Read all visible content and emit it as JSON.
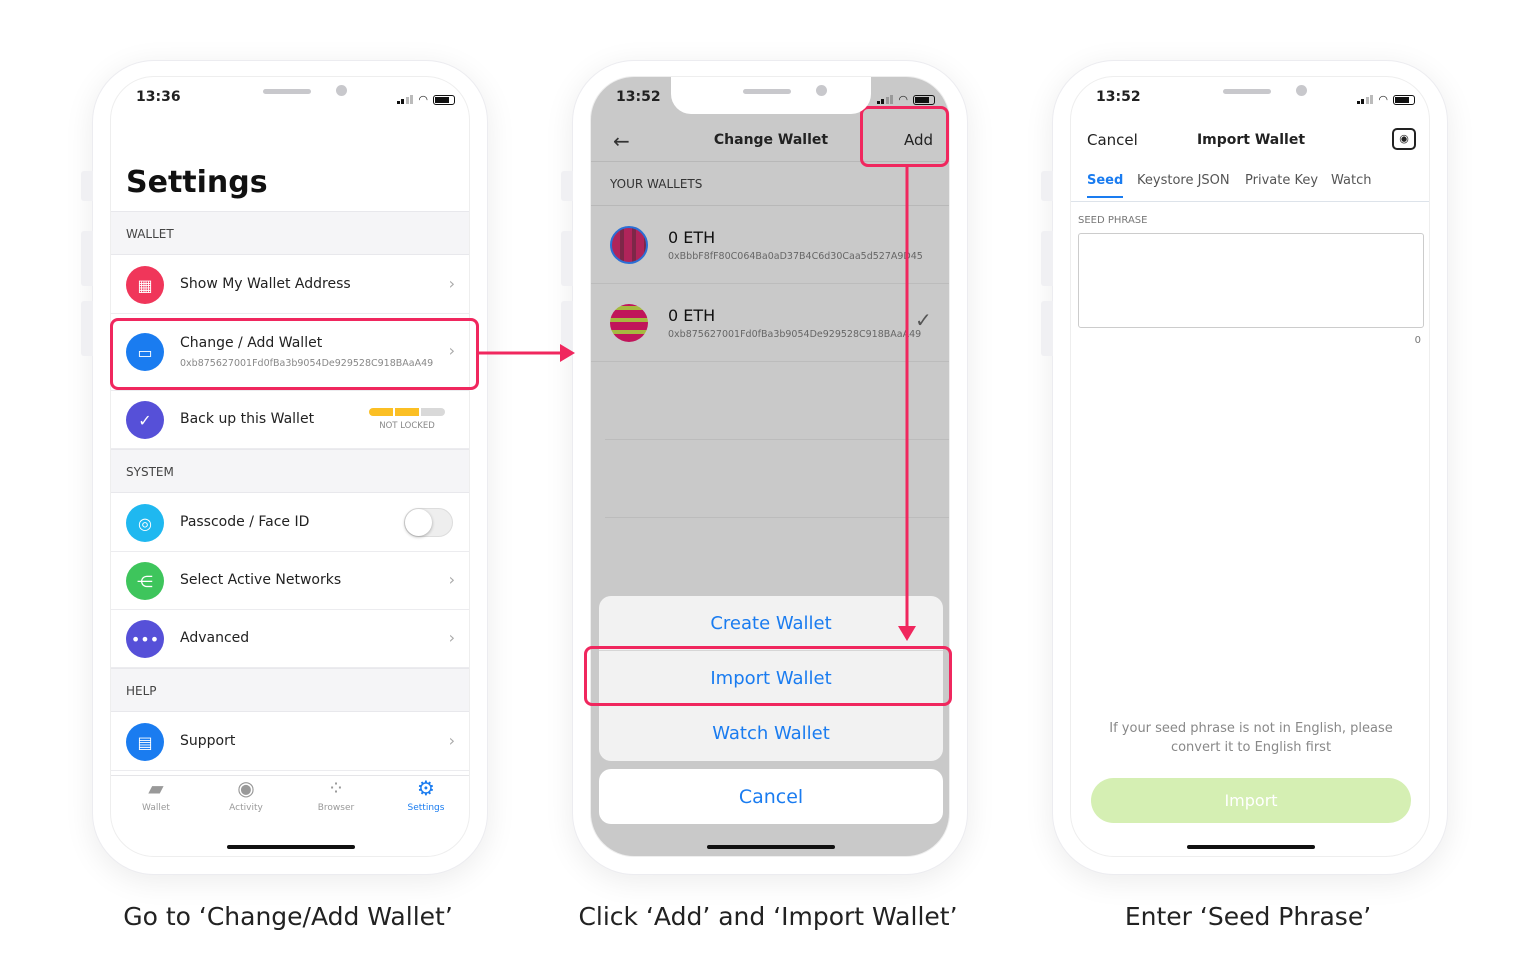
{
  "colors": {
    "accent": "#1a7cf0",
    "highlight": "#f0275e",
    "import_disabled": "#d5efb3"
  },
  "phone1": {
    "time": "13:36",
    "title": "Settings",
    "sections": {
      "wallet": "WALLET",
      "system": "SYSTEM",
      "help": "HELP"
    },
    "rows": {
      "show_address": "Show My Wallet Address",
      "change_wallet": "Change / Add Wallet",
      "change_wallet_address": "0xb875627001Fd0fBa3b9054De929528C918BAaA49",
      "backup": "Back up this Wallet",
      "backup_status": "NOT LOCKED",
      "backup_progress": "2 of 3",
      "passcode": "Passcode / Face ID",
      "passcode_enabled": false,
      "networks": "Select Active Networks",
      "advanced": "Advanced",
      "support": "Support"
    },
    "tabs": [
      {
        "label": "Wallet",
        "icon": "wallet-icon"
      },
      {
        "label": "Activity",
        "icon": "activity-icon"
      },
      {
        "label": "Browser",
        "icon": "browser-icon"
      },
      {
        "label": "Settings",
        "icon": "gear-icon",
        "active": true
      }
    ]
  },
  "phone2": {
    "time": "13:52",
    "title": "Change Wallet",
    "add": "Add",
    "section": "YOUR WALLETS",
    "wallets": [
      {
        "balance": "0 ETH",
        "address": "0xBbbF8fF80C064Ba0aD37B4C6d30Caa5d527A9D45",
        "selected": false
      },
      {
        "balance": "0 ETH",
        "address": "0xb875627001Fd0fBa3b9054De929528C918BAaA49",
        "selected": true
      }
    ],
    "sheet": {
      "create": "Create Wallet",
      "import": "Import Wallet",
      "watch": "Watch Wallet",
      "cancel": "Cancel"
    }
  },
  "phone3": {
    "time": "13:52",
    "cancel": "Cancel",
    "title": "Import Wallet",
    "tabs": [
      "Seed",
      "Keystore JSON",
      "Private Key",
      "Watch"
    ],
    "active_tab": "Seed",
    "label": "SEED PHRASE",
    "seed_value": "",
    "char_count": "0",
    "hint_line1": "If your seed phrase is not in English, please",
    "hint_line2": "convert it to English first",
    "import": "Import"
  },
  "captions": [
    "Go to ‘Change/Add Wallet’",
    "Click ‘Add’ and ‘Import Wallet’",
    "Enter ‘Seed Phrase’"
  ]
}
